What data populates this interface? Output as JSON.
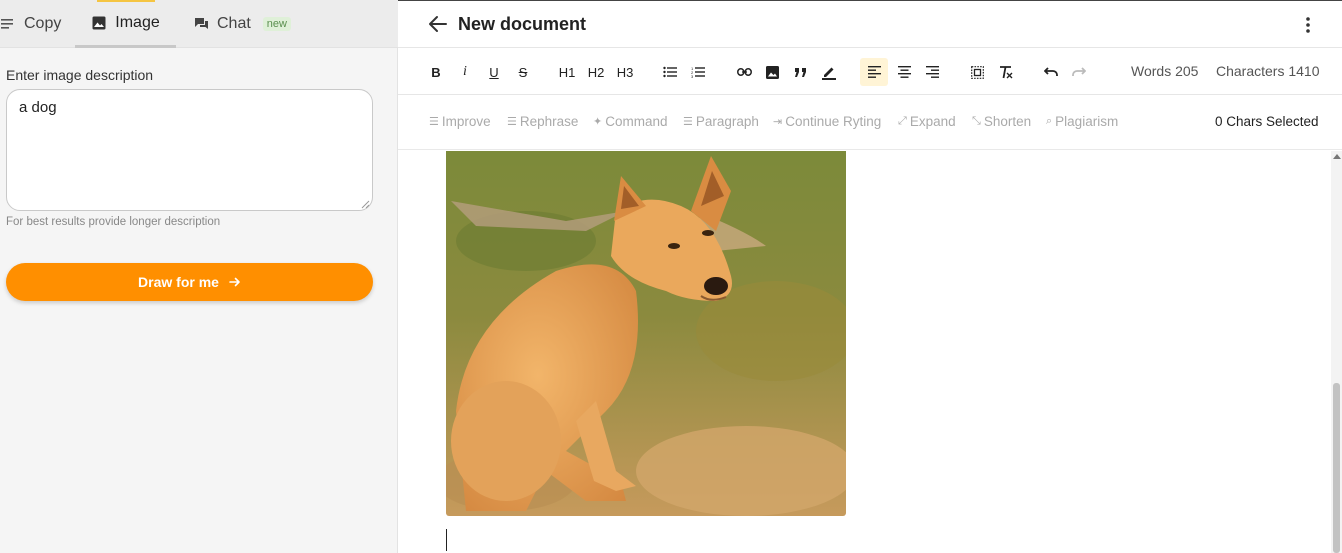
{
  "tabs": {
    "copy": "Copy",
    "image": "Image",
    "chat": "Chat",
    "chat_badge": "new"
  },
  "image_panel": {
    "description_label": "Enter image description",
    "description_value": "a dog",
    "hint": "For best results provide longer description",
    "draw_button": "Draw for me"
  },
  "header": {
    "title": "New document"
  },
  "toolbar": {
    "bold": "B",
    "italic": "i",
    "underline": "U",
    "strike": "S",
    "h1": "H1",
    "h2": "H2",
    "h3": "H3",
    "words": "Words 205",
    "characters": "Characters 1410"
  },
  "ai_actions": {
    "improve": "Improve",
    "rephrase": "Rephrase",
    "command": "Command",
    "paragraph": "Paragraph",
    "continue": "Continue Ryting",
    "expand": "Expand",
    "shorten": "Shorten",
    "plagiarism": "Plagiarism",
    "chars_selected": "0 Chars Selected"
  },
  "colors": {
    "accent": "#ff8f00",
    "active_tool_bg": "#fff4d6",
    "tab_highlight": "#f5c542"
  },
  "icons": [
    "menu-lines-icon",
    "image-icon",
    "chat-icon",
    "arrow-right-icon",
    "arrow-left-icon",
    "more-vertical-icon",
    "bullet-list-icon",
    "numbered-list-icon",
    "link-icon",
    "insert-image-icon",
    "quote-icon",
    "highlight-pen-icon",
    "align-left-icon",
    "align-center-icon",
    "align-right-icon",
    "select-all-icon",
    "clear-format-icon",
    "undo-icon",
    "redo-icon"
  ]
}
